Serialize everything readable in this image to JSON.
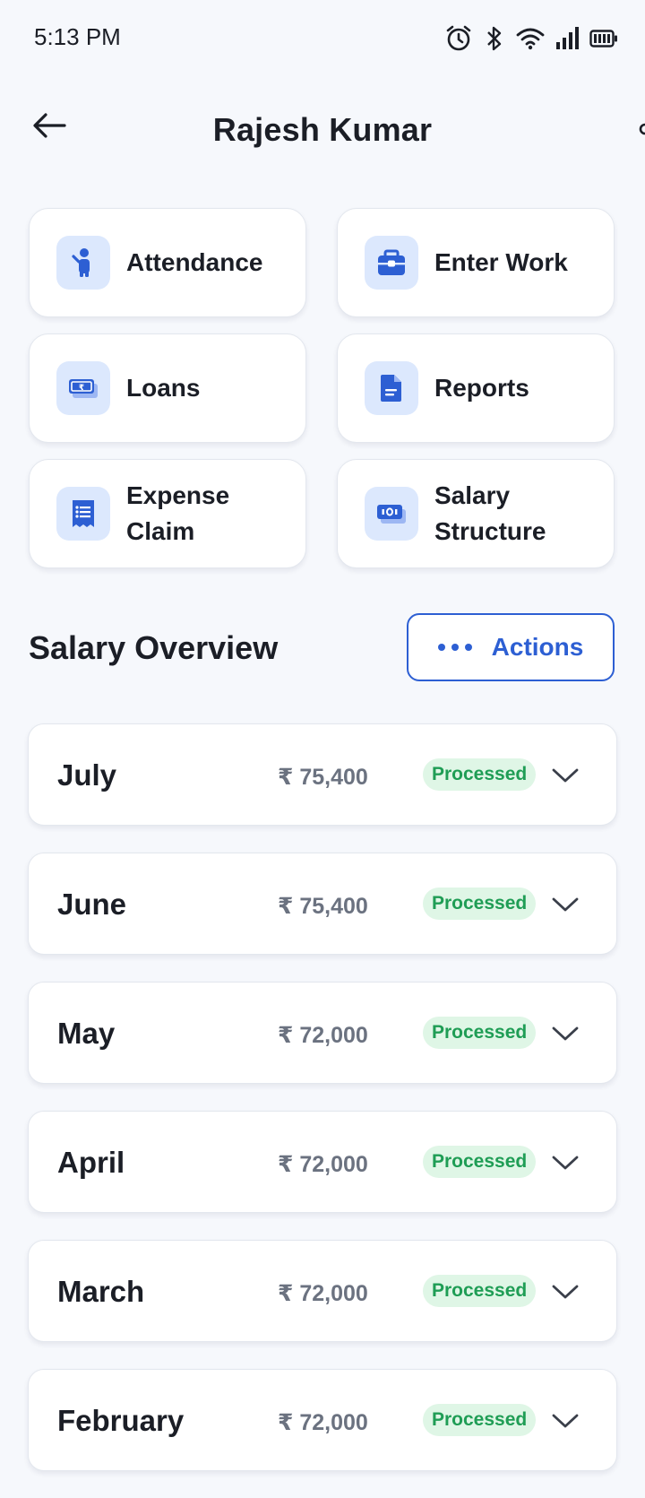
{
  "status_bar": {
    "time": "5:13 PM",
    "icons": [
      "alarm-icon",
      "bluetooth-icon",
      "wifi-icon",
      "signal-icon",
      "battery-icon"
    ]
  },
  "header": {
    "title": "Rajesh Kumar"
  },
  "quick_actions": [
    {
      "label": "Attendance",
      "icon": "person-icon"
    },
    {
      "label": "Enter Work",
      "icon": "briefcase-icon"
    },
    {
      "label": "Loans",
      "icon": "money-icon"
    },
    {
      "label": "Reports",
      "icon": "document-icon"
    },
    {
      "label": "Expense Claim",
      "label_lines": [
        "Expense",
        "Claim"
      ],
      "icon": "receipt-icon"
    },
    {
      "label": "Salary Structure",
      "label_lines": [
        "Salary",
        "Structure"
      ],
      "icon": "cash-icon"
    }
  ],
  "salary_overview": {
    "title": "Salary Overview",
    "actions_label": "Actions",
    "rows": [
      {
        "month": "July",
        "amount": "₹ 75,400",
        "status": "Processed"
      },
      {
        "month": "June",
        "amount": "₹ 75,400",
        "status": "Processed"
      },
      {
        "month": "May",
        "amount": "₹ 72,000",
        "status": "Processed"
      },
      {
        "month": "April",
        "amount": "₹ 72,000",
        "status": "Processed"
      },
      {
        "month": "March",
        "amount": "₹ 72,000",
        "status": "Processed"
      },
      {
        "month": "February",
        "amount": "₹ 72,000",
        "status": "Processed"
      }
    ]
  },
  "colors": {
    "accent": "#2d5fd3",
    "icon_bg": "#dce8fd",
    "badge_bg": "#dff6e6",
    "badge_text": "#1f9d55",
    "background": "#f6f8fc"
  }
}
